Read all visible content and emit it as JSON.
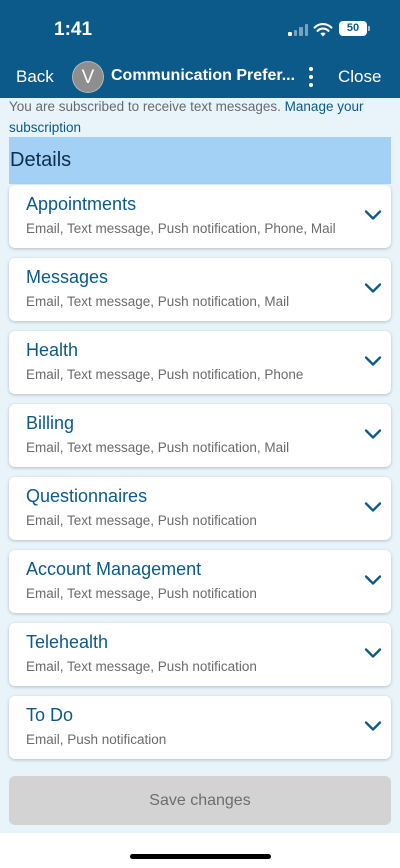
{
  "status_bar": {
    "time": "1:41",
    "battery": "50"
  },
  "nav": {
    "back_label": "Back",
    "avatar_letter": "V",
    "title": "Communication Prefer...",
    "close_label": "Close"
  },
  "subscription": {
    "text": "You are subscribed to receive text messages.",
    "link": "Manage your subscription"
  },
  "section_title": "Details",
  "categories": [
    {
      "title": "Appointments",
      "channels": "Email, Text message, Push notification, Phone, Mail"
    },
    {
      "title": "Messages",
      "channels": "Email, Text message, Push notification, Mail"
    },
    {
      "title": "Health",
      "channels": "Email, Text message, Push notification, Phone"
    },
    {
      "title": "Billing",
      "channels": "Email, Text message, Push notification, Mail"
    },
    {
      "title": "Questionnaires",
      "channels": "Email, Text message, Push notification"
    },
    {
      "title": "Account Management",
      "channels": "Email, Text message, Push notification"
    },
    {
      "title": "Telehealth",
      "channels": "Email, Text message, Push notification"
    },
    {
      "title": "To Do",
      "channels": "Email, Push notification"
    }
  ],
  "save_label": "Save changes",
  "colors": {
    "header_bg": "#0b5a8a",
    "accent": "#0b5a8a",
    "section_bg": "#a3d0f5",
    "page_bg": "#e8f3fa",
    "disabled_button": "#d3d3d3"
  },
  "icons": [
    "cellular-signal-icon",
    "wifi-icon",
    "battery-icon",
    "more-vertical-icon",
    "chevron-down-icon"
  ]
}
